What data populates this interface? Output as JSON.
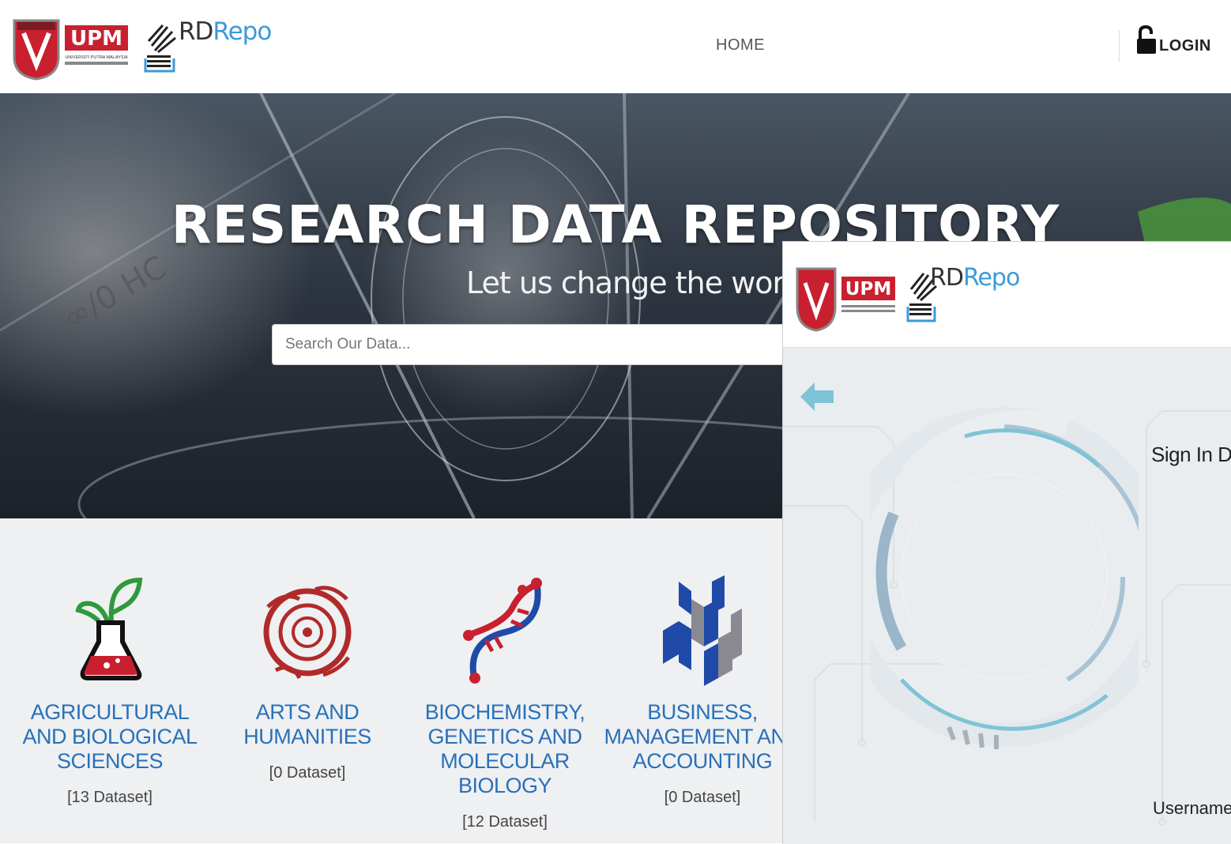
{
  "header": {
    "upm_logo_text": "UPM",
    "upm_logo_subtext": "UNIVERSITI PUTRA MALAYSIA",
    "rd_logo_prefix": "RD",
    "rd_logo_suffix": "Repo",
    "nav_home": "HOME",
    "login_label": "LOGIN"
  },
  "hero": {
    "title": "RESEARCH DATA REPOSITORY",
    "subtitle": "Let us change the world",
    "search_placeholder": "Search Our Data..."
  },
  "categories": [
    {
      "name": "AGRICULTURAL AND BIOLOGICAL SCIENCES",
      "count": "[13 Dataset]",
      "icon": "plant-flask-icon"
    },
    {
      "name": "ARTS AND HUMANITIES",
      "count": "[0 Dataset]",
      "icon": "ornament-icon"
    },
    {
      "name": "BIOCHEMISTRY, GENETICS AND MOLECULAR BIOLOGY",
      "count": "[12 Dataset]",
      "icon": "dna-icon"
    },
    {
      "name": "BUSINESS, MANAGEMENT AND ACCOUNTING",
      "count": "[0 Dataset]",
      "icon": "blocks-icon"
    }
  ],
  "signin_panel": {
    "upm_logo_text": "UPM",
    "rd_logo_prefix": "RD",
    "rd_logo_suffix": "Repo",
    "title": "Sign In Dat",
    "username_label": "Username :"
  },
  "colors": {
    "accent_blue": "#2970b8",
    "repo_blue": "#3b9ad9",
    "upm_red": "#c8202f",
    "category_bg": "#eef0f2"
  }
}
